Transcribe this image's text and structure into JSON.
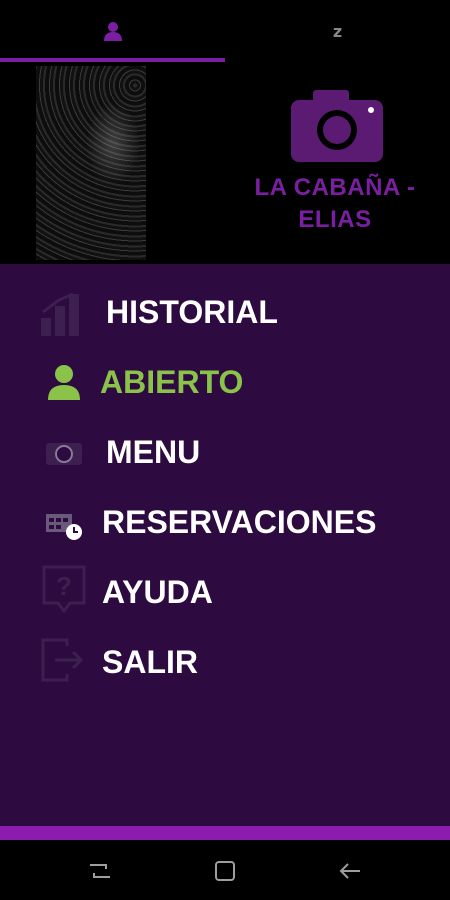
{
  "tabs": [
    {
      "icon": "person-icon"
    },
    {
      "icon": "sleep-icon",
      "glyph": "z"
    }
  ],
  "header": {
    "brand_line1": "LA CABAÑA -",
    "brand_line2": "ELIAS",
    "camera_icon": "camera-icon"
  },
  "menu": {
    "items": [
      {
        "label": "HISTORIAL",
        "icon": "bar-chart-icon",
        "active": false
      },
      {
        "label": "ABIERTO",
        "icon": "person-icon",
        "active": true
      },
      {
        "label": "MENU",
        "icon": "menu-icon",
        "active": false
      },
      {
        "label": "RESERVACIONES",
        "icon": "calendar-clock-icon",
        "active": false
      },
      {
        "label": "AYUDA",
        "icon": "help-icon",
        "active": false
      },
      {
        "label": "SALIR",
        "icon": "exit-icon",
        "active": false
      }
    ]
  },
  "navbar": {
    "buttons": [
      "recent-apps-icon",
      "home-icon",
      "back-icon"
    ]
  },
  "colors": {
    "accent": "#7b1fa2",
    "drawer_bg": "#2d0a3f",
    "active": "#8bc34a",
    "strip": "#8e1bb0"
  }
}
